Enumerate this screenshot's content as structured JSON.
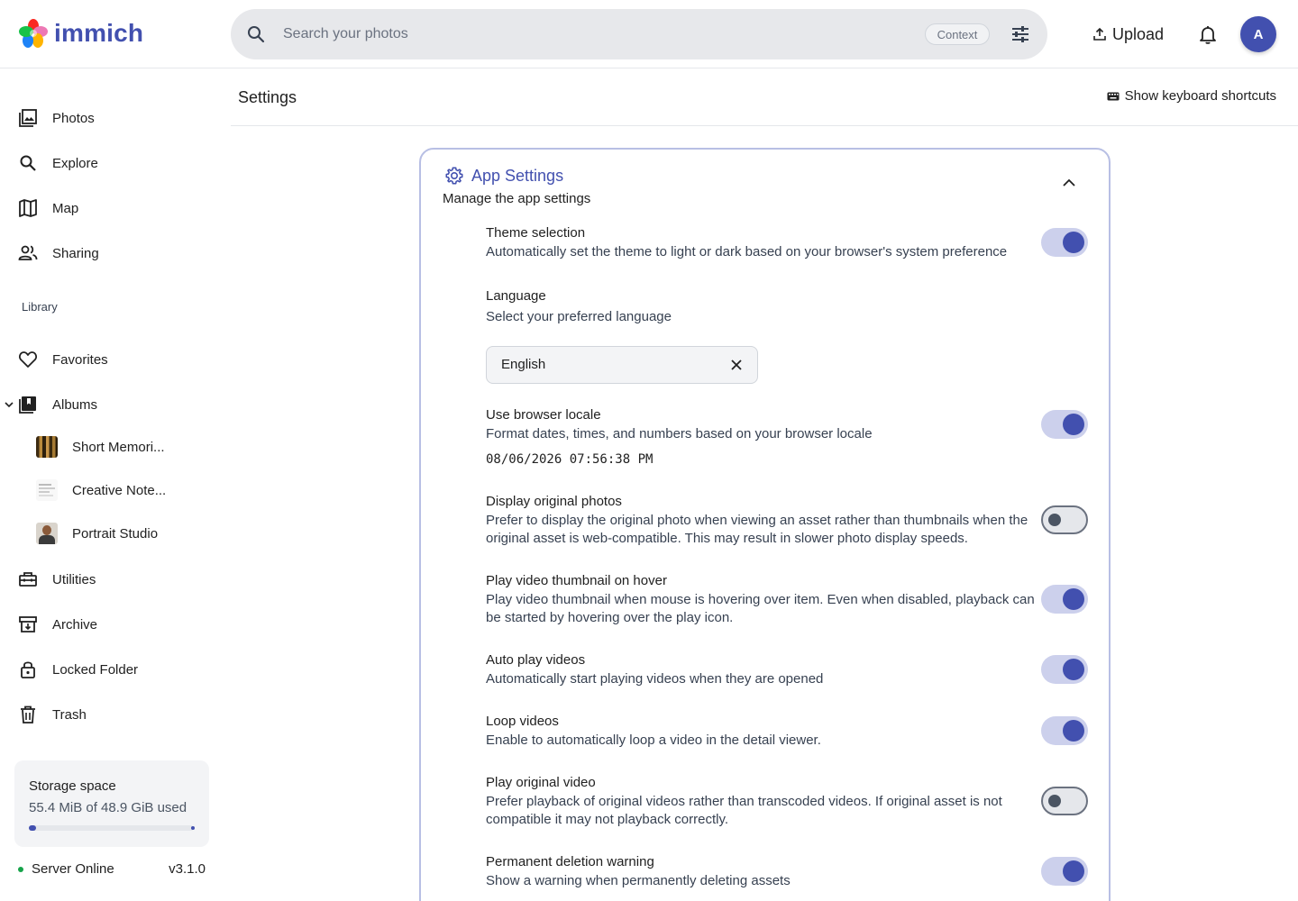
{
  "app": {
    "name": "immich",
    "brand_color": "#4250af"
  },
  "header": {
    "search_placeholder": "Search your photos",
    "context_label": "Context",
    "upload_label": "Upload",
    "avatar_initial": "A"
  },
  "sidebar": {
    "items": [
      {
        "label": "Photos",
        "icon": "photos-icon"
      },
      {
        "label": "Explore",
        "icon": "search-icon"
      },
      {
        "label": "Map",
        "icon": "map-icon"
      },
      {
        "label": "Sharing",
        "icon": "people-icon"
      }
    ],
    "library_label": "Library",
    "library_items": [
      {
        "label": "Favorites",
        "icon": "heart-icon"
      },
      {
        "label": "Albums",
        "icon": "album-icon"
      }
    ],
    "albums": [
      {
        "label": "Short Memori..."
      },
      {
        "label": "Creative Note..."
      },
      {
        "label": "Portrait Studio"
      }
    ],
    "more_items": [
      {
        "label": "Utilities",
        "icon": "toolbox-icon"
      },
      {
        "label": "Archive",
        "icon": "archive-icon"
      },
      {
        "label": "Locked Folder",
        "icon": "lock-icon"
      },
      {
        "label": "Trash",
        "icon": "trash-icon"
      }
    ],
    "storage": {
      "title": "Storage space",
      "usage": "55.4 MiB of 48.9 GiB used",
      "fraction_used": 0.001
    },
    "server": {
      "status": "Server Online",
      "version": "v3.1.0"
    }
  },
  "main": {
    "page_title": "Settings",
    "keyboard_shortcuts_label": "Show keyboard shortcuts",
    "card": {
      "title": "App Settings",
      "subtitle": "Manage the app settings",
      "settings": [
        {
          "title": "Theme selection",
          "desc": "Automatically set the theme to light or dark based on your browser's system preference",
          "enabled": true
        },
        {
          "title": "Language",
          "desc": "Select your preferred language"
        },
        {
          "title": "Use browser locale",
          "desc": "Format dates, times, and numbers based on your browser locale",
          "enabled": true
        },
        {
          "title": "Display original photos",
          "desc": "Prefer to display the original photo when viewing an asset rather than thumbnails when the original asset is web-compatible. This may result in slower photo display speeds.",
          "enabled": false
        },
        {
          "title": "Play video thumbnail on hover",
          "desc": "Play video thumbnail when mouse is hovering over item. Even when disabled, playback can be started by hovering over the play icon.",
          "enabled": true
        },
        {
          "title": "Auto play videos",
          "desc": "Automatically start playing videos when they are opened",
          "enabled": true
        },
        {
          "title": "Loop videos",
          "desc": "Enable to automatically loop a video in the detail viewer.",
          "enabled": true
        },
        {
          "title": "Play original video",
          "desc": "Prefer playback of original videos rather than transcoded videos. If original asset is not compatible it may not playback correctly.",
          "enabled": false
        },
        {
          "title": "Permanent deletion warning",
          "desc": "Show a warning when permanently deleting assets",
          "enabled": true
        }
      ],
      "language_value": "English",
      "locale_example": "08/06/2026 07:56:38 PM"
    }
  }
}
